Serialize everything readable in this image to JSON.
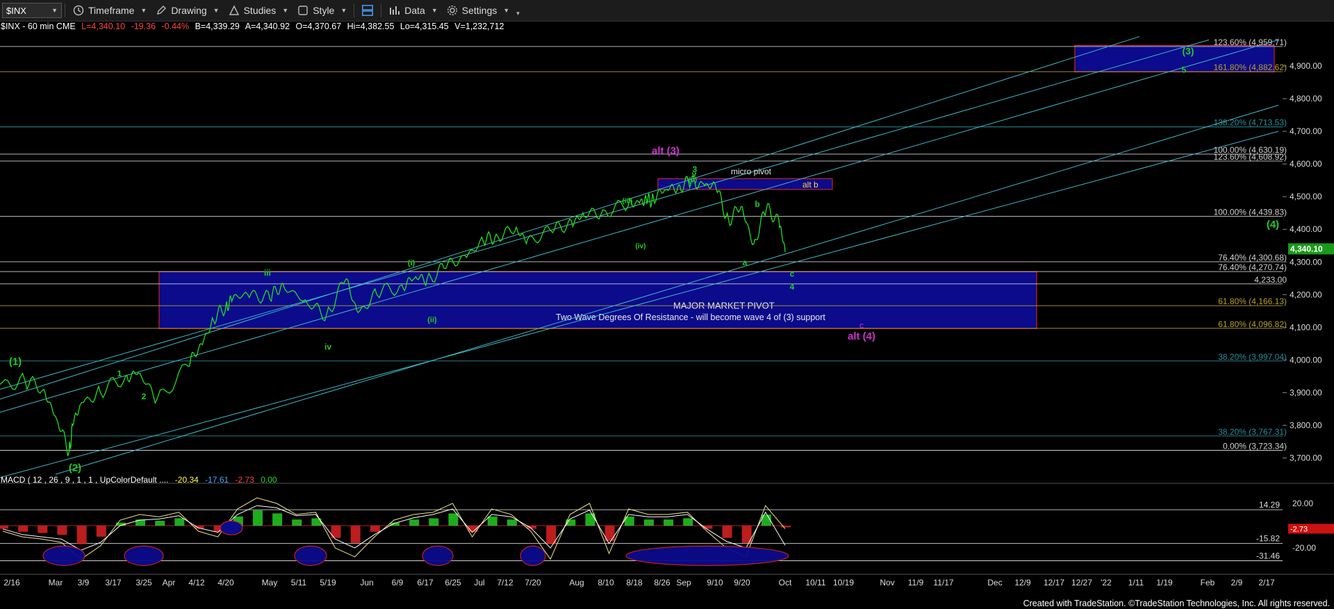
{
  "toolbar": {
    "symbol": "$INX",
    "timeframe_label": "Timeframe",
    "drawing_label": "Drawing",
    "studies_label": "Studies",
    "style_label": "Style",
    "data_label": "Data",
    "settings_label": "Settings"
  },
  "infobar": {
    "title": "$INX - 60 min  CME",
    "last": "L=4,340.10",
    "change": "-19.36",
    "change_pct": "-0.44%",
    "bid": "B=4,339.29",
    "ask": "A=4,340.92",
    "open": "O=4,370.67",
    "high": "Hi=4,382.55",
    "low": "Lo=4,315.45",
    "volume": "V=1,232,712"
  },
  "macd": {
    "label": "MACD ( 12 , 26 , 9 , 1 , 1 , UpColorDefault ....",
    "v1": "-20.34",
    "v2": "-17.61",
    "v3": "-2.73",
    "v4": "0.00",
    "levels": [
      "14.29",
      "-15.82",
      "-31.46"
    ],
    "axis_ticks": [
      "20.00",
      "-20.00"
    ],
    "current": "-2.73"
  },
  "footer": "Created with TradeStation. ©TradeStation Technologies, Inc. All rights reserved.",
  "colors": {
    "price": "#22dd22",
    "fib_line": "#cfcfcf",
    "zone_fill": "#0b0b8c",
    "zone_border": "#cc2222",
    "channel": "#3fb8c8",
    "alt_label": "#cc33cc",
    "wave_label": "#22cc22"
  },
  "chart_data": {
    "type": "line",
    "title": "$INX - 60 min",
    "price_axis": {
      "min": 3650,
      "max": 5000,
      "ticks": [
        "4,900.00",
        "4,800.00",
        "4,700.00",
        "4,600.00",
        "4,500.00",
        "4,400.00",
        "4,300.00",
        "4,200.00",
        "4,100.00",
        "4,000.00",
        "3,900.00",
        "3,800.00",
        "3,700.00"
      ],
      "last_price": "4,340.10",
      "last_value": 4340.1
    },
    "x_axis_labels": [
      "2/16",
      "Mar",
      "3/9",
      "3/17",
      "3/25",
      "Apr",
      "4/12",
      "4/20",
      "May",
      "5/11",
      "5/19",
      "Jun",
      "6/9",
      "6/17",
      "6/25",
      "Jul",
      "7/12",
      "7/20",
      "Aug",
      "8/10",
      "8/18",
      "8/26",
      "Sep",
      "9/10",
      "9/20",
      "Oct",
      "10/11",
      "10/19",
      "Nov",
      "11/9",
      "11/17",
      "Dec",
      "12/9",
      "12/17",
      "12/27",
      "'22",
      "1/11",
      "1/19",
      "Feb",
      "2/9",
      "2/17"
    ],
    "fib_levels": [
      {
        "label": "123.60% (4,959.71)",
        "value": 4959.71,
        "color": "#d0d0d0"
      },
      {
        "label": "161.80% (4,882.62)",
        "value": 4882.62,
        "color": "#b8a02a"
      },
      {
        "label": "138.20% (4,713.53)",
        "value": 4713.53,
        "color": "#2a8f9a"
      },
      {
        "label": "100.00% (4,630.19)",
        "value": 4630.19,
        "color": "#d0d0d0"
      },
      {
        "label": "123.60% (4,608.92)",
        "value": 4608.92,
        "color": "#d0d0d0"
      },
      {
        "label": "100.00% (4,439.83)",
        "value": 4439.83,
        "color": "#d0d0d0"
      },
      {
        "label": "76.40% (4,300.68)",
        "value": 4300.68,
        "color": "#d0d0d0"
      },
      {
        "label": "76.40% (4,270.74)",
        "value": 4270.74,
        "color": "#d0d0d0"
      },
      {
        "label": "4,233.00",
        "value": 4233.0,
        "color": "#d0d0d0"
      },
      {
        "label": "61.80% (4,166.13)",
        "value": 4166.13,
        "color": "#b8a02a"
      },
      {
        "label": "61.80% (4,096.82)",
        "value": 4096.82,
        "color": "#b8a02a"
      },
      {
        "label": "38.20% (3,997.04)",
        "value": 3997.04,
        "color": "#2a8f9a"
      },
      {
        "label": "38.20% (3,767.31)",
        "value": 3767.31,
        "color": "#2a8f9a"
      },
      {
        "label": "0.00% (3,723.34)",
        "value": 3723.34,
        "color": "#d0d0d0"
      }
    ],
    "zones": [
      {
        "label": "",
        "top": 4963,
        "bottom": 4882
      },
      {
        "label": "alt b",
        "top": 4555,
        "bottom": 4522
      },
      {
        "label": "MAJOR MARKET PIVOT",
        "top": 4270,
        "bottom": 4096
      }
    ],
    "annotations": {
      "micro_pivot": "micro pivot",
      "pivot_note": "Two Wave Degrees Of Resistance - will become wave 4 of (3) support",
      "alt3": "alt (3)",
      "alt4": "alt (4)",
      "alt_c": "c",
      "wave_labels": [
        "(1)",
        "(2)",
        "(3)",
        "(4)",
        "1",
        "2",
        "3",
        "4",
        "5",
        "iii",
        "iv",
        "(i)",
        "(ii)",
        "(iii)",
        "(iv)",
        "(v)",
        "v",
        "a",
        "b",
        "c"
      ]
    },
    "series": [
      {
        "x": [
          0,
          0.02,
          0.035,
          0.045,
          0.055,
          0.058,
          0.065,
          0.08,
          0.1,
          0.11,
          0.125,
          0.15,
          0.16,
          0.17,
          0.18,
          0.185,
          0.2,
          0.215,
          0.225,
          0.245,
          0.26,
          0.275,
          0.285,
          0.3,
          0.32,
          0.33,
          0.34,
          0.355,
          0.37,
          0.385,
          0.395,
          0.41,
          0.42,
          0.44,
          0.455,
          0.465,
          0.48,
          0.5,
          0.51,
          0.515,
          0.52,
          0.53,
          0.54,
          0.55,
          0.56,
          0.57,
          0.58,
          0.59,
          0.6,
          0.61,
          0.62,
          0.625
        ],
        "values": [
          3925,
          3935,
          3910,
          3820,
          3720,
          3800,
          3870,
          3900,
          3950,
          3960,
          3880,
          3980,
          4050,
          4120,
          4170,
          4185,
          4205,
          4185,
          4235,
          4170,
          4140,
          4245,
          4145,
          4200,
          4230,
          4250,
          4250,
          4280,
          4320,
          4360,
          4385,
          4395,
          4370,
          4390,
          4425,
          4440,
          4460,
          4470,
          4490,
          4480,
          4500,
          4520,
          4535,
          4540,
          4540,
          4525,
          4430,
          4470,
          4355,
          4460,
          4430,
          4330
        ]
      }
    ],
    "macd_series": [
      {
        "name": "MACD",
        "values": [
          -5,
          -10,
          -12,
          -15,
          -30,
          -18,
          5,
          10,
          8,
          12,
          -5,
          -10,
          15,
          25,
          20,
          10,
          12,
          -20,
          -28,
          -10,
          5,
          10,
          12,
          20,
          -10,
          15,
          10,
          -5,
          -30,
          10,
          20,
          -25,
          15,
          10,
          10,
          12,
          -5,
          -20,
          -28,
          18,
          -2.73
        ]
      },
      {
        "name": "Signal",
        "values": [
          -3,
          -8,
          -10,
          -12,
          -22,
          -15,
          0,
          5,
          6,
          9,
          -2,
          -6,
          10,
          18,
          16,
          9,
          10,
          -12,
          -20,
          -8,
          2,
          7,
          10,
          15,
          -6,
          10,
          8,
          -2,
          -20,
          6,
          14,
          -16,
          10,
          8,
          8,
          10,
          -3,
          -14,
          -20,
          12,
          -17.61
        ]
      }
    ]
  }
}
